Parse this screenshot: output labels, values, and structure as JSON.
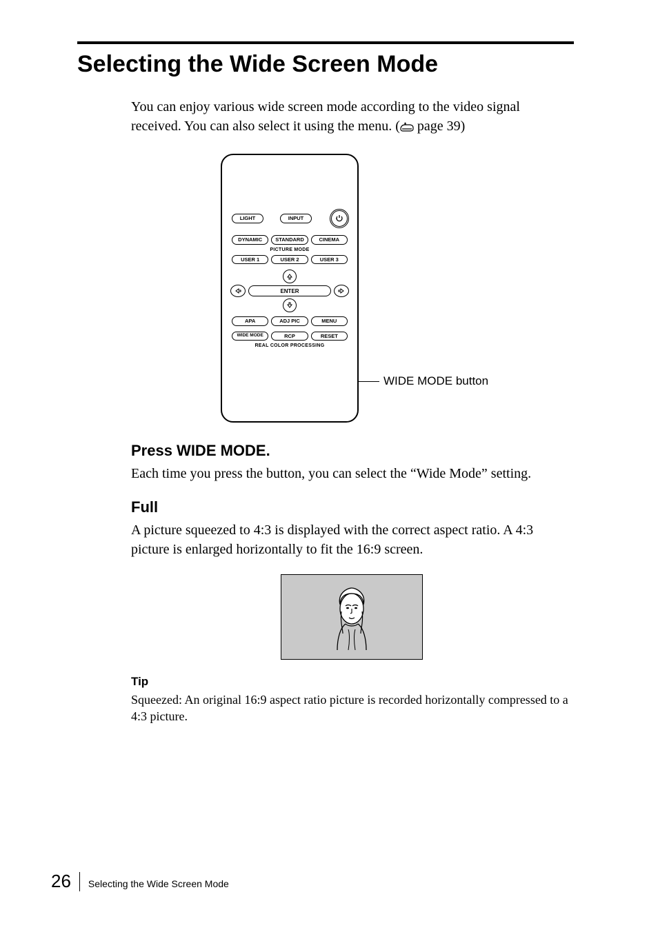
{
  "title": "Selecting the Wide Screen Mode",
  "intro_line1": "You can enjoy various wide screen mode according to the video signal",
  "intro_line2": "received. You can also select it using the menu. (",
  "intro_pageref": " page 39)",
  "remote": {
    "light": "LIGHT",
    "input": "INPUT",
    "dynamic": "DYNAMIC",
    "standard": "STANDARD",
    "cinema": "CINEMA",
    "picture_mode": "PICTURE MODE",
    "user1": "USER 1",
    "user2": "USER 2",
    "user3": "USER 3",
    "enter": "ENTER",
    "apa": "APA",
    "adj_pic": "ADJ PIC",
    "menu": "MENU",
    "wide_mode": "WIDE MODE",
    "rcp": "RCP",
    "reset": "RESET",
    "rcp_label": "REAL COLOR PROCESSING"
  },
  "callout": "WIDE MODE button",
  "step_heading": "Press WIDE MODE.",
  "step_body": "Each time you press the button, you can select the “Wide Mode” setting.",
  "mode_heading": "Full",
  "mode_body": "A picture squeezed to 4:3 is displayed with the correct aspect ratio. A 4:3 picture is enlarged horizontally to fit the 16:9 screen.",
  "tip_label": "Tip",
  "tip_body": "Squeezed: An original 16:9 aspect ratio picture is recorded horizontally compressed to a 4:3 picture.",
  "footer": {
    "page": "26",
    "title": "Selecting the Wide Screen Mode"
  }
}
